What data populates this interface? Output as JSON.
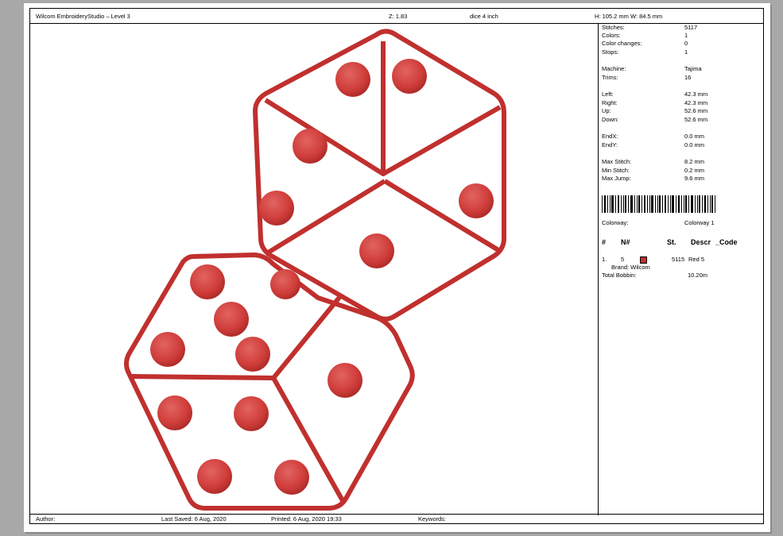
{
  "header": {
    "app_title": "Wilcom EmbroideryStudio – Level 3",
    "zoom": "Z: 1.83",
    "design_name": "dice 4 inch",
    "dimensions": "H: 105.2 mm  W: 84.5 mm"
  },
  "stats": {
    "stitches_label": "Stitches:",
    "stitches": "5117",
    "colors_label": "Colors:",
    "colors": "1",
    "color_changes_label": "Color changes:",
    "color_changes": "0",
    "stops_label": "Stops:",
    "stops": "1",
    "machine_label": "Machine:",
    "machine": "Tajima",
    "trims_label": "Trims:",
    "trims": "16",
    "left_label": "Left:",
    "left": "42.3 mm",
    "right_label": "Right:",
    "right": "42.3 mm",
    "up_label": "Up:",
    "up": "52.6 mm",
    "down_label": "Down:",
    "down": "52.6 mm",
    "endx_label": "EndX:",
    "endx": "0.0 mm",
    "endy_label": "EndY:",
    "endy": "0.0 mm",
    "max_stitch_label": "Max Stitch:",
    "max_stitch": "8.2 mm",
    "min_stitch_label": "Min Stitch:",
    "min_stitch": "0.2 mm",
    "max_jump_label": "Max Jump:",
    "max_jump": "9.6 mm",
    "colorway_label": "Colorway:",
    "colorway": "Colorway 1"
  },
  "color_table": {
    "headers": [
      "#",
      "N#",
      "St.",
      "Descr",
      "_Code"
    ],
    "rows": [
      {
        "index": "1.",
        "needle": "5",
        "stitches": "5115",
        "descr": "Red 5",
        "brand": "Brand: Wilcom",
        "color": "#c0302e"
      }
    ],
    "total_bobbin_label": "Total Bobbin:",
    "total_bobbin": "10.20m"
  },
  "footer": {
    "author": "Author:",
    "last_saved": "Last Saved:  6 Aug, 2020",
    "printed": "Printed:  6 Aug, 2020 19:33",
    "keywords": "Keywords:"
  },
  "colors": {
    "thread": "#c0302e",
    "thread_dark": "#9e2321",
    "background": "#a8a8a8"
  }
}
